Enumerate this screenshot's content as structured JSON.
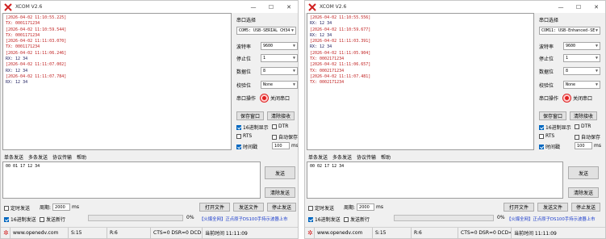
{
  "left": {
    "title": "XCOM V2.6",
    "recv_lines": [
      {
        "kind": "ts",
        "text": "[2026-04-02 11:10:55.225]"
      },
      {
        "kind": "tx",
        "text": "TX: 0001171234"
      },
      {
        "kind": "ts",
        "text": "[2026-04-02 11:10:59.544]"
      },
      {
        "kind": "tx",
        "text": "TX: 0001171234"
      },
      {
        "kind": "ts",
        "text": "[2026-04-02 11:11:03.070]"
      },
      {
        "kind": "tx",
        "text": "TX: 0001171234"
      },
      {
        "kind": "ts",
        "text": "[2026-04-02 11:11:06.246]"
      },
      {
        "kind": "rx",
        "text": "RX: 12 34"
      },
      {
        "kind": "ts",
        "text": "[2026-04-02 11:11:07.002]"
      },
      {
        "kind": "rx",
        "text": "RX: 12 34"
      },
      {
        "kind": "ts",
        "text": "[2026-04-02 11:11:07.784]"
      },
      {
        "kind": "rx",
        "text": "RX: 12 34"
      }
    ],
    "port_label": "串口选择",
    "port_value": "COM5: USB-SERIAL CH34",
    "baud_label": "波特率",
    "baud_value": "9600",
    "stop_label": "停止位",
    "stop_value": "1",
    "data_label": "数据位",
    "data_value": "8",
    "parity_label": "校验位",
    "parity_value": "None",
    "op_label": "串口操作",
    "op_button": "关闭串口",
    "save_button": "保存窗口",
    "clear_button": "清除接收",
    "hex_show": "16进制显示",
    "dtr": "DTR",
    "rts": "RTS",
    "auto_save": "自动保存",
    "timestamp": "时间戳",
    "ts_ms": "100",
    "ms": "ms",
    "tabs": [
      "单条发送",
      "多条发送",
      "协议传输",
      "帮助"
    ],
    "send_text": "00 01 17 12 34",
    "send_button": "发送",
    "clear_send_button": "清除发送",
    "timed_send": "定时发送",
    "period_label": "周期:",
    "period_value": "2000",
    "period_unit": "ms",
    "open_file": "打开文件",
    "send_file": "发送文件",
    "stop_send": "停止发送",
    "hex_send": "16进制发送",
    "send_newline": "发送新行",
    "progress": "0%",
    "promo": "【火爆全网】正点原子DS100手持示波器上市",
    "website": "www.openedv.com",
    "s_count": "S:15",
    "r_count": "R:6",
    "signals": "CTS=0 DSR=0 DCD=0",
    "time": "当前时间 11:11:09"
  },
  "right": {
    "title": "XCOM V2.6",
    "recv_lines": [
      {
        "kind": "ts",
        "text": "[2026-04-02 11:10:55.556]"
      },
      {
        "kind": "rx",
        "text": "RX: 12 34"
      },
      {
        "kind": "ts",
        "text": "[2026-04-02 11:10:59.677]"
      },
      {
        "kind": "rx",
        "text": "RX: 12 34"
      },
      {
        "kind": "ts",
        "text": "[2026-04-02 11:11:03.391]"
      },
      {
        "kind": "rx",
        "text": "RX: 12 34"
      },
      {
        "kind": "ts",
        "text": "[2026-04-02 11:11:05.904]"
      },
      {
        "kind": "tx",
        "text": "TX: 0002171234"
      },
      {
        "kind": "ts",
        "text": "[2026-04-02 11:11:06.657]"
      },
      {
        "kind": "tx",
        "text": "TX: 0002171234"
      },
      {
        "kind": "ts",
        "text": "[2026-04-02 11:11:07.481]"
      },
      {
        "kind": "tx",
        "text": "TX: 0002171234"
      }
    ],
    "port_label": "串口选择",
    "port_value": "COM11: USB-Enhanced-SE",
    "baud_label": "波特率",
    "baud_value": "9600",
    "stop_label": "停止位",
    "stop_value": "1",
    "data_label": "数据位",
    "data_value": "8",
    "parity_label": "校验位",
    "parity_value": "None",
    "op_label": "串口操作",
    "op_button": "关闭串口",
    "save_button": "保存窗口",
    "clear_button": "清除接收",
    "hex_show": "16进制显示",
    "dtr": "DTR",
    "rts": "RTS",
    "auto_save": "自动保存",
    "timestamp": "时间戳",
    "ts_ms": "100",
    "ms": "ms",
    "tabs": [
      "单条发送",
      "多条发送",
      "协议传输",
      "帮助"
    ],
    "send_text": "00 02 17 12 34",
    "send_button": "发送",
    "clear_send_button": "清除发送",
    "timed_send": "定时发送",
    "period_label": "周期:",
    "period_value": "2000",
    "period_unit": "ms",
    "open_file": "打开文件",
    "send_file": "发送文件",
    "stop_send": "停止发送",
    "hex_send": "16进制发送",
    "send_newline": "发送新行",
    "progress": "0%",
    "promo": "【火爆全网】正点原子DS100手持示波器上市",
    "website": "www.openedv.com",
    "s_count": "S:15",
    "r_count": "R:6",
    "signals": "CTS=0 DSR=0 DCD=0",
    "time": "当前时间 11:11:09"
  },
  "window_controls": {
    "minimize": "—",
    "maximize": "☐",
    "close": "✕"
  },
  "colors": {
    "accent": "#0067c0",
    "led": "#e02020",
    "timestamp": "#c02020",
    "promo": "#1a3ccc"
  }
}
